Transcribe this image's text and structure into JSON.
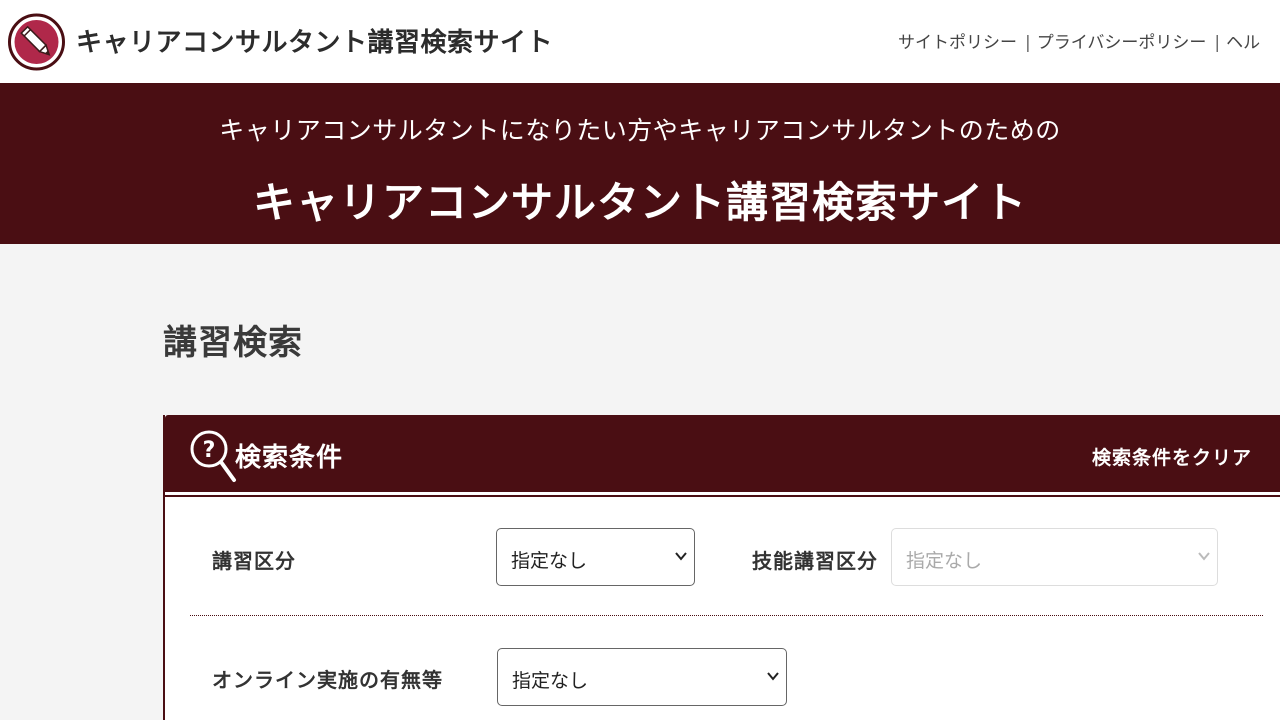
{
  "header": {
    "site_title": "キャリアコンサルタント講習検索サイト",
    "links": [
      "サイトポリシー",
      "プライバシーポリシー",
      "ヘル"
    ]
  },
  "banner": {
    "subtitle": "キャリアコンサルタントになりたい方やキャリアコンサルタントのための",
    "title": "キャリアコンサルタント講習検索サイト"
  },
  "main": {
    "page_title": "講習検索",
    "panel": {
      "title": "検索条件",
      "clear_label": "検索条件をクリア",
      "fields": {
        "course_category": {
          "label": "講習区分",
          "value": "指定なし"
        },
        "skill_category": {
          "label": "技能講習区分",
          "value": "指定なし"
        },
        "online": {
          "label": "オンライン実施の有無等",
          "value": "指定なし"
        }
      }
    }
  },
  "colors": {
    "brand": "#4a0e13",
    "background": "#f4f4f4"
  }
}
